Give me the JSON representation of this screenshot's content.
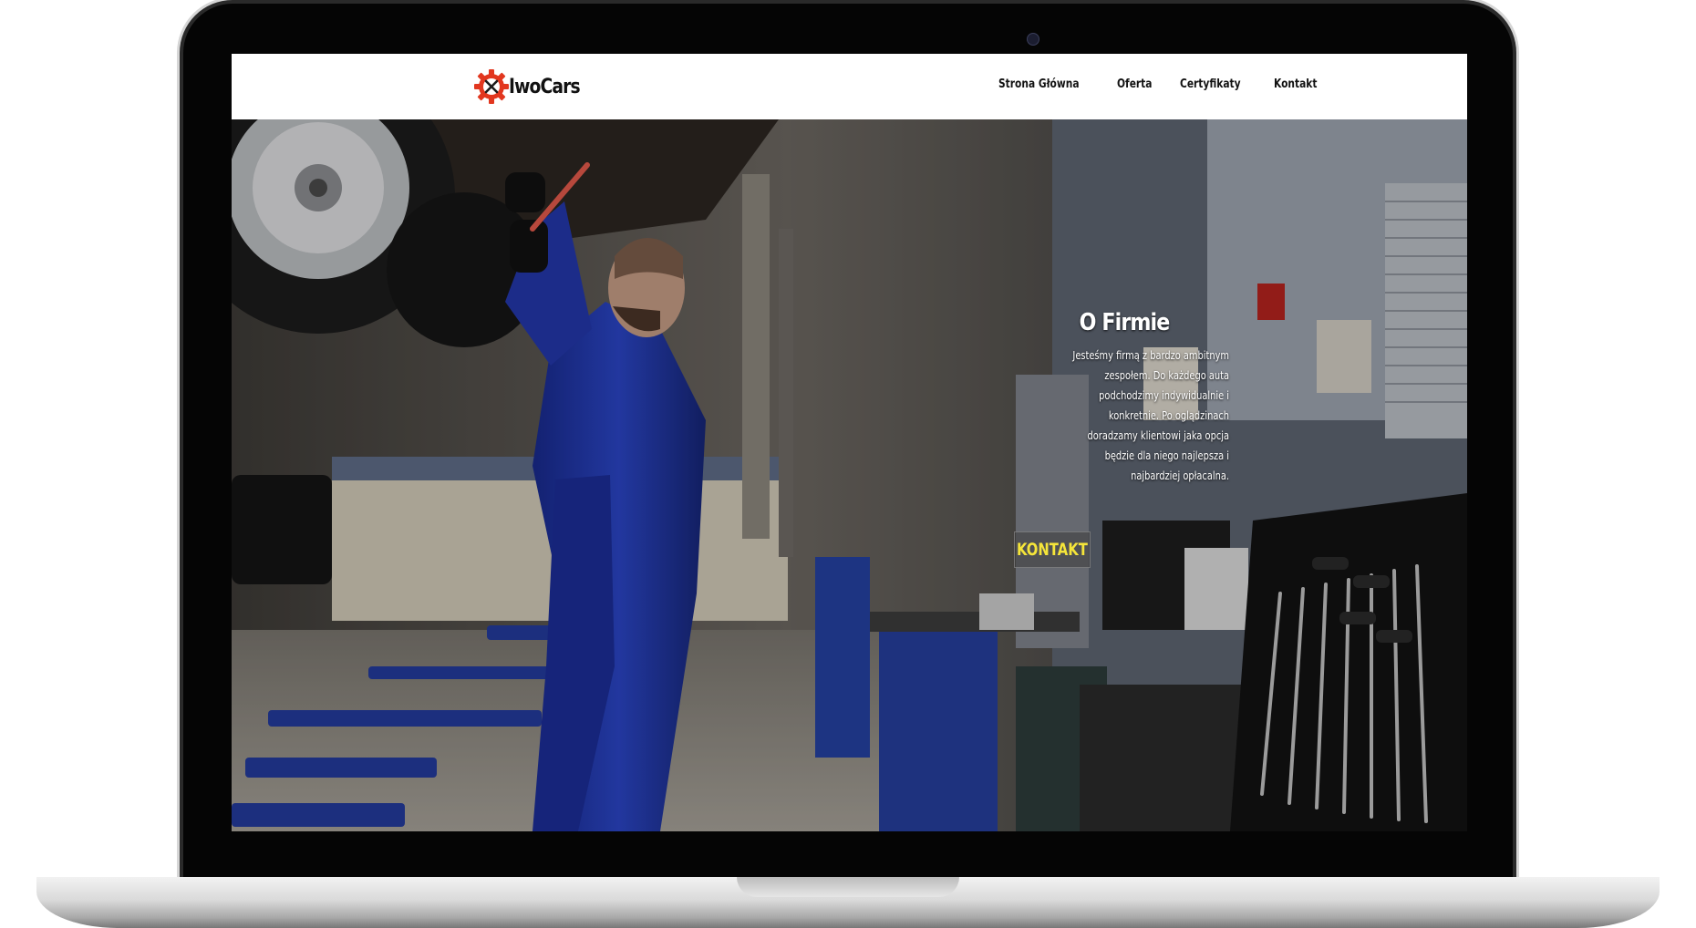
{
  "logo": {
    "text": "IwoCars"
  },
  "nav": {
    "items": [
      {
        "label": "Strona Główna"
      },
      {
        "label": "Oferta"
      },
      {
        "label": "Certyfikaty"
      },
      {
        "label": "Kontakt"
      }
    ]
  },
  "hero": {
    "about_title": "O Firmie",
    "about_text": "Jesteśmy firmą z bardzo ambitnym zespołem. Do każdego auta podchodzimy indywidualnie i konkretnie. Po oglądzinach doradzamy klientowi jaka opcja będzie dla niego najlepsza i najbardziej opłacalna.",
    "cta_label": "KONTAKT"
  },
  "colors": {
    "accent": "#f5e53a",
    "logo_red": "#e2371f",
    "overall_blue": "#1f36a6"
  }
}
